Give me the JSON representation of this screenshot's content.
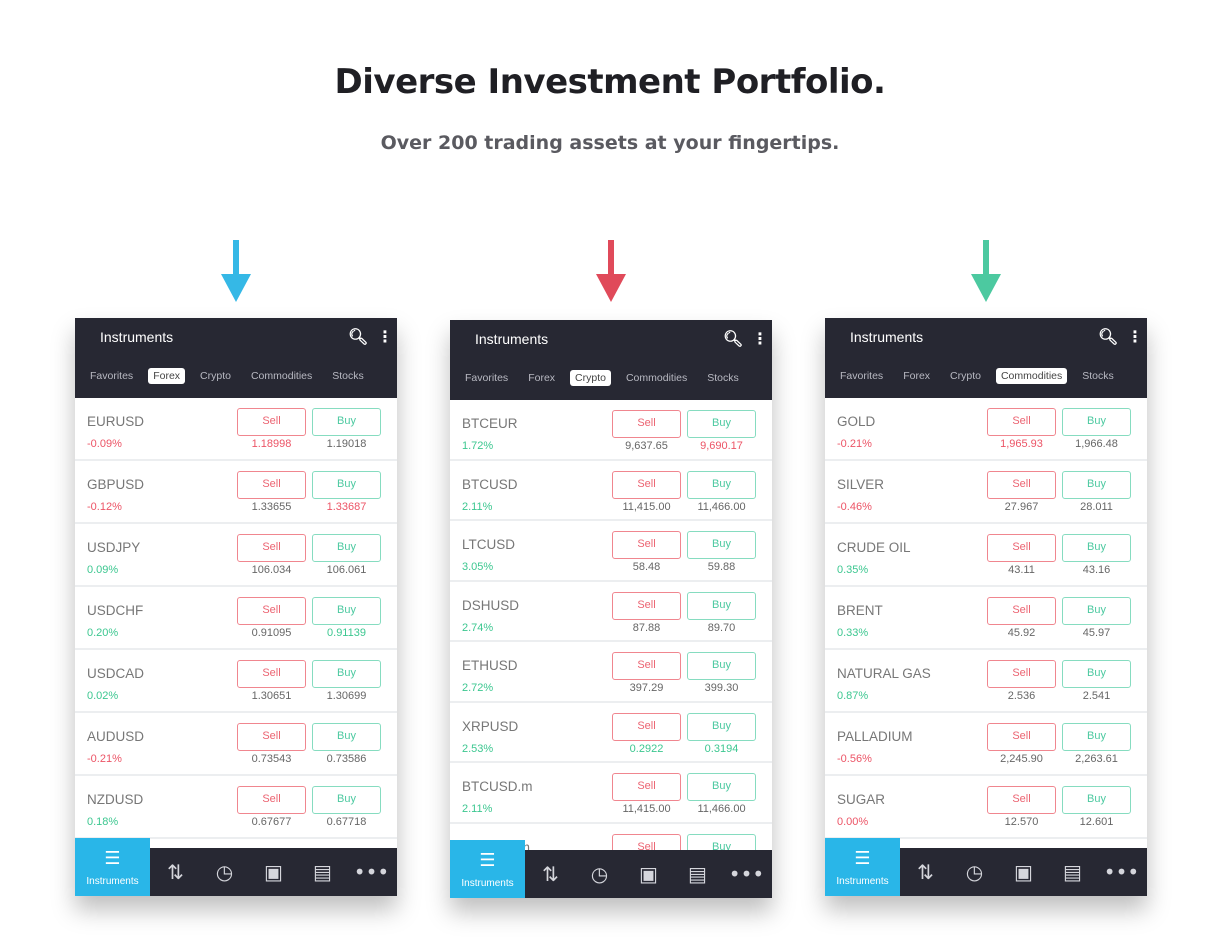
{
  "title": "Diverse Investment Portfolio.",
  "subtitle": "Over 200 trading assets at your fingertips.",
  "colors": {
    "arrow1": "#35b8e6",
    "arrow2": "#e04a5a",
    "arrow3": "#4cc9a0",
    "header": "#272833",
    "active_nav": "#29b6e8"
  },
  "phones": [
    {
      "header": "Instruments",
      "tabs": [
        "Favorites",
        "Forex",
        "Crypto",
        "Commodities",
        "Stocks"
      ],
      "active_tab": 1,
      "sell_label": "Sell",
      "buy_label": "Buy",
      "nav_label": "Instruments",
      "rows": [
        {
          "symbol": "EURUSD",
          "change": "-0.09%",
          "change_color": "red",
          "sell": "1.18998",
          "sell_color": "red",
          "buy": "1.19018",
          "buy_color": "gray"
        },
        {
          "symbol": "GBPUSD",
          "change": "-0.12%",
          "change_color": "red",
          "sell": "1.33655",
          "sell_color": "gray",
          "buy": "1.33687",
          "buy_color": "red"
        },
        {
          "symbol": "USDJPY",
          "change": "0.09%",
          "change_color": "green",
          "sell": "106.034",
          "sell_color": "gray",
          "buy": "106.061",
          "buy_color": "gray"
        },
        {
          "symbol": "USDCHF",
          "change": "0.20%",
          "change_color": "green",
          "sell": "0.91095",
          "sell_color": "gray",
          "buy": "0.91139",
          "buy_color": "green"
        },
        {
          "symbol": "USDCAD",
          "change": "0.02%",
          "change_color": "green",
          "sell": "1.30651",
          "sell_color": "gray",
          "buy": "1.30699",
          "buy_color": "gray"
        },
        {
          "symbol": "AUDUSD",
          "change": "-0.21%",
          "change_color": "red",
          "sell": "0.73543",
          "sell_color": "gray",
          "buy": "0.73586",
          "buy_color": "gray"
        },
        {
          "symbol": "NZDUSD",
          "change": "0.18%",
          "change_color": "green",
          "sell": "0.67677",
          "sell_color": "gray",
          "buy": "0.67718",
          "buy_color": "gray"
        }
      ]
    },
    {
      "header": "Instruments",
      "tabs": [
        "Favorites",
        "Forex",
        "Crypto",
        "Commodities",
        "Stocks"
      ],
      "active_tab": 2,
      "sell_label": "Sell",
      "buy_label": "Buy",
      "nav_label": "Instruments",
      "rows": [
        {
          "symbol": "BTCEUR",
          "change": "1.72%",
          "change_color": "green",
          "sell": "9,637.65",
          "sell_color": "gray",
          "buy": "9,690.17",
          "buy_color": "red"
        },
        {
          "symbol": "BTCUSD",
          "change": "2.11%",
          "change_color": "green",
          "sell": "11,415.00",
          "sell_color": "gray",
          "buy": "11,466.00",
          "buy_color": "gray"
        },
        {
          "symbol": "LTCUSD",
          "change": "3.05%",
          "change_color": "green",
          "sell": "58.48",
          "sell_color": "gray",
          "buy": "59.88",
          "buy_color": "gray"
        },
        {
          "symbol": "DSHUSD",
          "change": "2.74%",
          "change_color": "green",
          "sell": "87.88",
          "sell_color": "gray",
          "buy": "89.70",
          "buy_color": "gray"
        },
        {
          "symbol": "ETHUSD",
          "change": "2.72%",
          "change_color": "green",
          "sell": "397.29",
          "sell_color": "gray",
          "buy": "399.30",
          "buy_color": "gray"
        },
        {
          "symbol": "XRPUSD",
          "change": "2.53%",
          "change_color": "green",
          "sell": "0.2922",
          "sell_color": "green",
          "buy": "0.3194",
          "buy_color": "green"
        },
        {
          "symbol": "BTCUSD.m",
          "change": "2.11%",
          "change_color": "green",
          "sell": "11,415.00",
          "sell_color": "gray",
          "buy": "11,466.00",
          "buy_color": "gray"
        },
        {
          "symbol": "LTCUSD.m",
          "change": "",
          "change_color": "green",
          "sell": "",
          "sell_color": "gray",
          "buy": "",
          "buy_color": "gray"
        }
      ]
    },
    {
      "header": "Instruments",
      "tabs": [
        "Favorites",
        "Forex",
        "Crypto",
        "Commodities",
        "Stocks"
      ],
      "active_tab": 3,
      "sell_label": "Sell",
      "buy_label": "Buy",
      "nav_label": "Instruments",
      "rows": [
        {
          "symbol": "GOLD",
          "change": "-0.21%",
          "change_color": "red",
          "sell": "1,965.93",
          "sell_color": "red",
          "buy": "1,966.48",
          "buy_color": "gray"
        },
        {
          "symbol": "SILVER",
          "change": "-0.46%",
          "change_color": "red",
          "sell": "27.967",
          "sell_color": "gray",
          "buy": "28.011",
          "buy_color": "gray"
        },
        {
          "symbol": "CRUDE OIL",
          "change": "0.35%",
          "change_color": "green",
          "sell": "43.11",
          "sell_color": "gray",
          "buy": "43.16",
          "buy_color": "gray"
        },
        {
          "symbol": "BRENT",
          "change": "0.33%",
          "change_color": "green",
          "sell": "45.92",
          "sell_color": "gray",
          "buy": "45.97",
          "buy_color": "gray"
        },
        {
          "symbol": "NATURAL GAS",
          "change": "0.87%",
          "change_color": "green",
          "sell": "2.536",
          "sell_color": "gray",
          "buy": "2.541",
          "buy_color": "gray"
        },
        {
          "symbol": "PALLADIUM",
          "change": "-0.56%",
          "change_color": "red",
          "sell": "2,245.90",
          "sell_color": "gray",
          "buy": "2,263.61",
          "buy_color": "gray"
        },
        {
          "symbol": "SUGAR",
          "change": "0.00%",
          "change_color": "red",
          "sell": "12.570",
          "sell_color": "gray",
          "buy": "12.601",
          "buy_color": "gray"
        }
      ]
    }
  ],
  "nav_icons": [
    "list-icon",
    "transfer-arrows-icon",
    "clock-icon",
    "wallet-icon",
    "document-icon",
    "more-icon"
  ]
}
